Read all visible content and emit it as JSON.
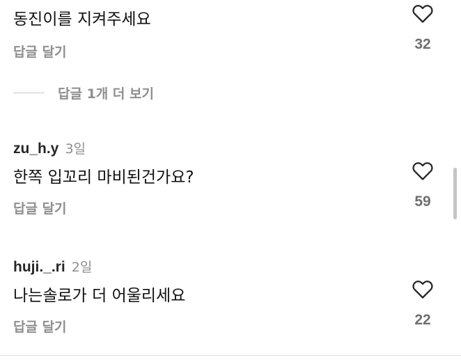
{
  "comments": [
    {
      "username": "",
      "time": "",
      "text": "동진이를 지켜주세요",
      "reply_label": "답글 달기",
      "like_count": "32",
      "like_icon": "heart-outline-icon"
    },
    {
      "username": "zu_h.y",
      "time": "3일",
      "text": "한쪽 입꼬리 마비된건가요?",
      "reply_label": "답글 달기",
      "like_count": "59",
      "like_icon": "heart-outline-icon"
    },
    {
      "username": "huji._.ri",
      "time": "2일",
      "text": "나는솔로가 더 어울리세요",
      "reply_label": "답글 달기",
      "like_count": "22",
      "like_icon": "heart-outline-icon"
    }
  ],
  "more_replies": {
    "label": "답글 1개 더 보기"
  },
  "colors": {
    "text": "#111111",
    "username": "#262626",
    "secondary": "#8e8e8e",
    "like_count": "#6f6f6f",
    "divider": "#c7c7c7"
  }
}
